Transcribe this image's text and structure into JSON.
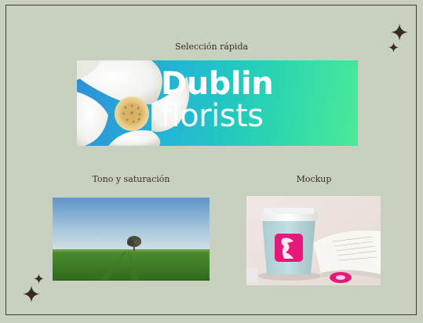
{
  "slide": {
    "captions": {
      "quick_selection": "Selección rápida",
      "hue_saturation": "Tono y saturación",
      "mockup": "Mockup"
    },
    "banner": {
      "brand_line_1": "Dublin",
      "brand_line_2": "florists"
    },
    "colors": {
      "background": "#c8d0bf",
      "frame": "#4a3a2a",
      "text": "#3a2e22",
      "accent_pink": "#e8187a"
    },
    "icons": [
      "sparkle-icon",
      "sparkle-icon",
      "sparkle-icon",
      "sparkle-icon"
    ]
  }
}
